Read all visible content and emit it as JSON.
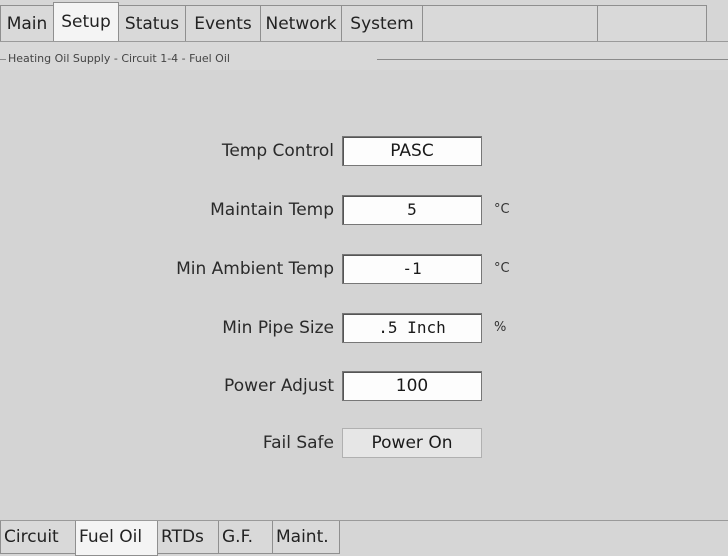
{
  "top_tabs": [
    {
      "label": "Main"
    },
    {
      "label": "Setup"
    },
    {
      "label": "Status"
    },
    {
      "label": "Events"
    },
    {
      "label": "Network"
    },
    {
      "label": "System"
    }
  ],
  "active_top_tab": "Setup",
  "group_title": "Heating Oil Supply - Circuit 1-4 - Fuel Oil",
  "fields": {
    "temp_control": {
      "label": "Temp Control",
      "value": "PASC"
    },
    "maintain_temp": {
      "label": "Maintain Temp",
      "value": "5",
      "unit": "°C"
    },
    "min_ambient_temp": {
      "label": "Min Ambient Temp",
      "value": "-1",
      "unit": "°C"
    },
    "min_pipe_size": {
      "label": "Min Pipe Size",
      "value": ".5 Inch",
      "unit": "%"
    },
    "power_adjust": {
      "label": "Power Adjust",
      "value": "100"
    },
    "fail_safe": {
      "label": "Fail Safe",
      "value": "Power On"
    }
  },
  "bottom_tabs": [
    {
      "label": "Circuit"
    },
    {
      "label": "Fuel Oil"
    },
    {
      "label": "RTDs"
    },
    {
      "label": "G.F."
    },
    {
      "label": "Maint."
    }
  ],
  "active_bottom_tab": "Fuel Oil"
}
